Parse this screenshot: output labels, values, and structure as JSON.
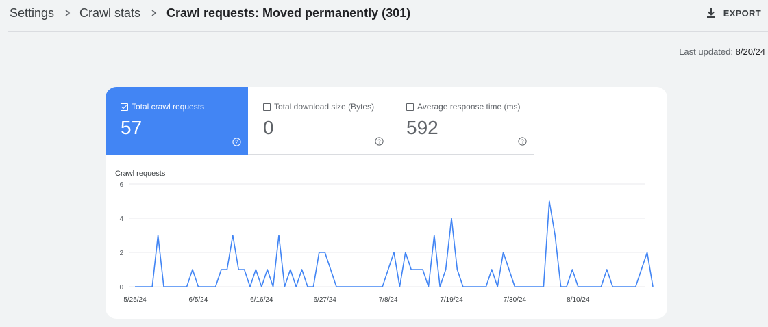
{
  "breadcrumb": {
    "items": [
      "Settings",
      "Crawl stats",
      "Crawl requests: Moved permanently (301)"
    ]
  },
  "toolbar": {
    "export_label": "EXPORT",
    "export_icon": "download-icon"
  },
  "last_updated": {
    "label": "Last updated:",
    "value": "8/20/24"
  },
  "metrics": [
    {
      "label": "Total crawl requests",
      "value": "57",
      "selected": true
    },
    {
      "label": "Total download size (Bytes)",
      "value": "0",
      "selected": false
    },
    {
      "label": "Average response time (ms)",
      "value": "592",
      "selected": false
    }
  ],
  "colors": {
    "accent": "#4285f4",
    "line": "#4285f4",
    "grid": "#e8eaed"
  },
  "chart_data": {
    "type": "line",
    "title": "Crawl requests",
    "ylim": [
      0,
      6
    ],
    "yticks": [
      0,
      2,
      4,
      6
    ],
    "xtick_labels": [
      "5/25/24",
      "6/5/24",
      "6/16/24",
      "6/27/24",
      "7/8/24",
      "7/19/24",
      "7/30/24",
      "8/10/24"
    ],
    "x_start": "5/25/24",
    "series": [
      {
        "values": [
          0,
          0,
          0,
          0,
          3,
          0,
          0,
          0,
          0,
          0,
          1,
          0,
          0,
          0,
          0,
          1,
          1,
          3,
          1,
          1,
          0,
          1,
          0,
          1,
          0,
          3,
          0,
          1,
          0,
          1,
          0,
          0,
          2,
          2,
          1,
          0,
          0,
          0,
          0,
          0,
          0,
          0,
          0,
          0,
          1,
          2,
          0,
          2,
          1,
          1,
          1,
          0,
          3,
          0,
          1,
          4,
          1,
          0,
          0,
          0,
          0,
          0,
          1,
          0,
          2,
          1,
          0,
          0,
          0,
          0,
          0,
          0,
          5,
          3,
          0,
          0,
          1,
          0,
          0,
          0,
          0,
          0,
          1,
          0,
          0,
          0,
          0,
          0,
          1,
          2,
          0
        ]
      }
    ]
  }
}
